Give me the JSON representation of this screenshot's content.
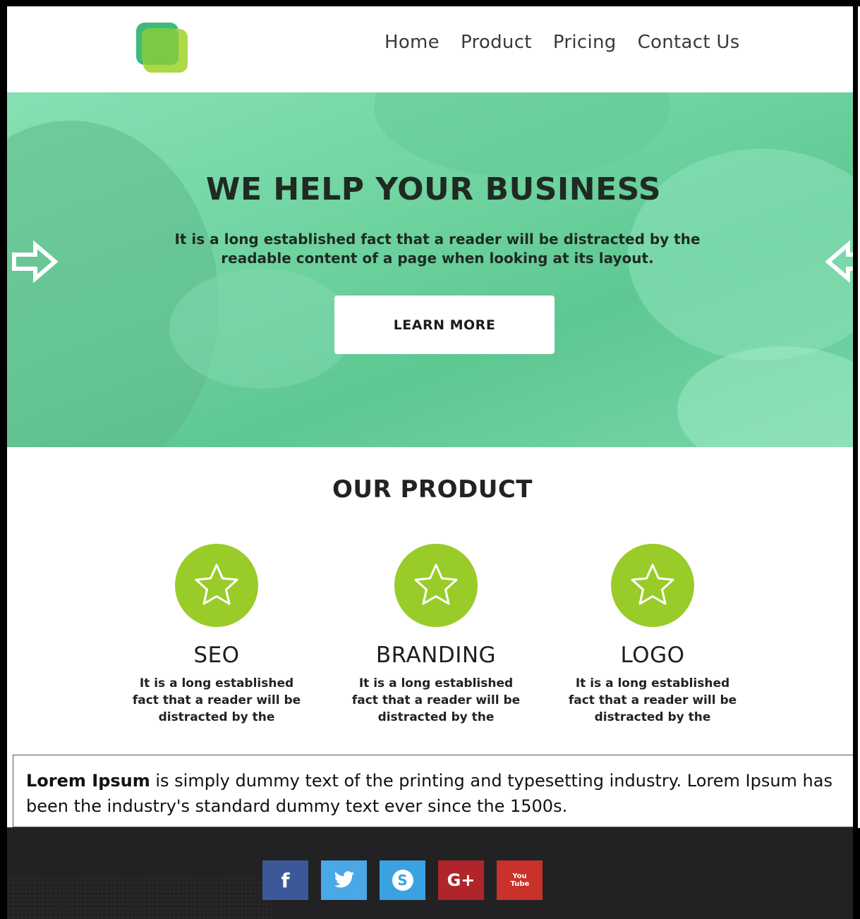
{
  "nav": {
    "items": [
      "Home",
      "Product",
      "Pricing",
      "Contact Us"
    ]
  },
  "hero": {
    "title": "WE HELP YOUR BUSINESS",
    "tagline": "It is a long established fact that a reader will be distracted by the readable content of a page when looking at its layout.",
    "cta_label": "LEARN MORE",
    "overlay_color": "#6fd3a0"
  },
  "product": {
    "title": "OUR PRODUCT",
    "cards": [
      {
        "title": "SEO",
        "text": "It is a long established fact that a reader will be distracted by the",
        "icon": "star-icon"
      },
      {
        "title": "BRANDING",
        "text": "It is a long established fact that a reader will be distracted by the",
        "icon": "star-icon"
      },
      {
        "title": "LOGO",
        "text": "It is a long established fact that a reader will be distracted by the",
        "icon": "star-icon"
      }
    ],
    "accent_color": "#99cc29"
  },
  "lorem": {
    "bold": "Lorem Ipsum",
    "text": " is simply dummy text of the printing and typesetting industry. Lorem Ipsum has been the industry's standard dummy text ever since the 1500s."
  },
  "footer": {
    "socials": [
      {
        "name": "facebook-icon",
        "glyph": "f",
        "color": "#3b5998"
      },
      {
        "name": "twitter-icon",
        "glyph": "t",
        "color": "#4aa8e6"
      },
      {
        "name": "skype-icon",
        "glyph": "S",
        "color": "#3aa2e2"
      },
      {
        "name": "google-plus-icon",
        "glyph": "G+",
        "color": "#b0252a"
      },
      {
        "name": "youtube-icon",
        "glyph": "You Tube",
        "color": "#c8322b"
      }
    ]
  }
}
